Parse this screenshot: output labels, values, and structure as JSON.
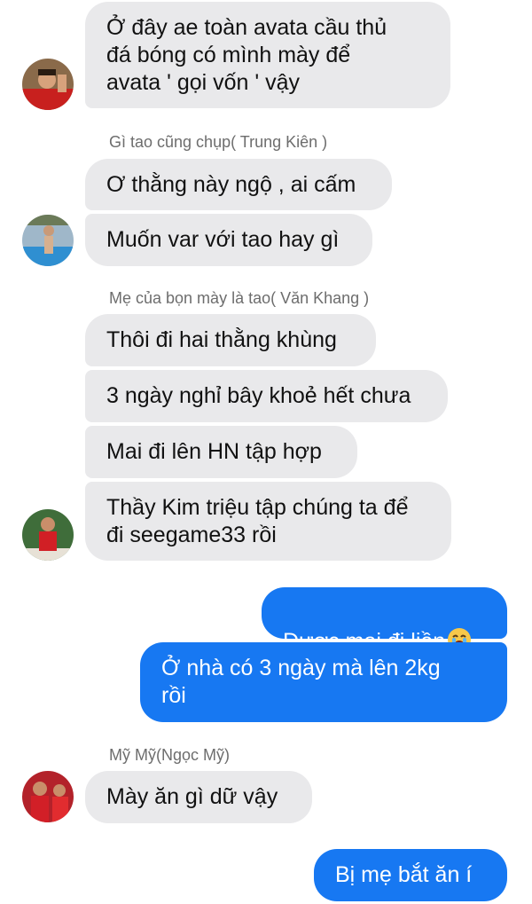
{
  "messages": [
    {
      "id": "m1",
      "text": "Ở đây ae toàn avata cầu thủ\nđá bóng có mình mày để\navata ' gọi vốn ' vậy"
    },
    {
      "id": "s1",
      "sender": "Gì tao cũng chụp( Trung Kiên )"
    },
    {
      "id": "m2",
      "text": "Ơ thằng này ngộ , ai cấm"
    },
    {
      "id": "m3",
      "text": "Muốn var với tao hay gì"
    },
    {
      "id": "s2",
      "sender": "Mẹ của bọn mày là tao( Văn Khang )"
    },
    {
      "id": "m4",
      "text": "Thôi đi hai thằng khùng"
    },
    {
      "id": "m5",
      "text": "3 ngày nghỉ bây khoẻ hết chưa"
    },
    {
      "id": "m6",
      "text": "Mai đi lên HN tập hợp"
    },
    {
      "id": "m7",
      "text": "Thầy Kim triệu tập chúng ta để\nđi seegame33 rồi"
    },
    {
      "id": "m8",
      "text": "Được mai đi liền"
    },
    {
      "id": "m9",
      "text": "Ở nhà có 3 ngày mà lên 2kg\nrồi"
    },
    {
      "id": "s3",
      "sender": "Mỹ Mỹ(Ngọc Mỹ)"
    },
    {
      "id": "m10",
      "text": "Mày ăn gì dữ vậy"
    },
    {
      "id": "m11",
      "text": "Bị mẹ bắt ăn í"
    }
  ],
  "emoji": "loudly-crying-face-icon",
  "colors": {
    "outgoing": "#1778f2",
    "incoming": "#e9e9eb",
    "sender": "#6d6d6d"
  }
}
